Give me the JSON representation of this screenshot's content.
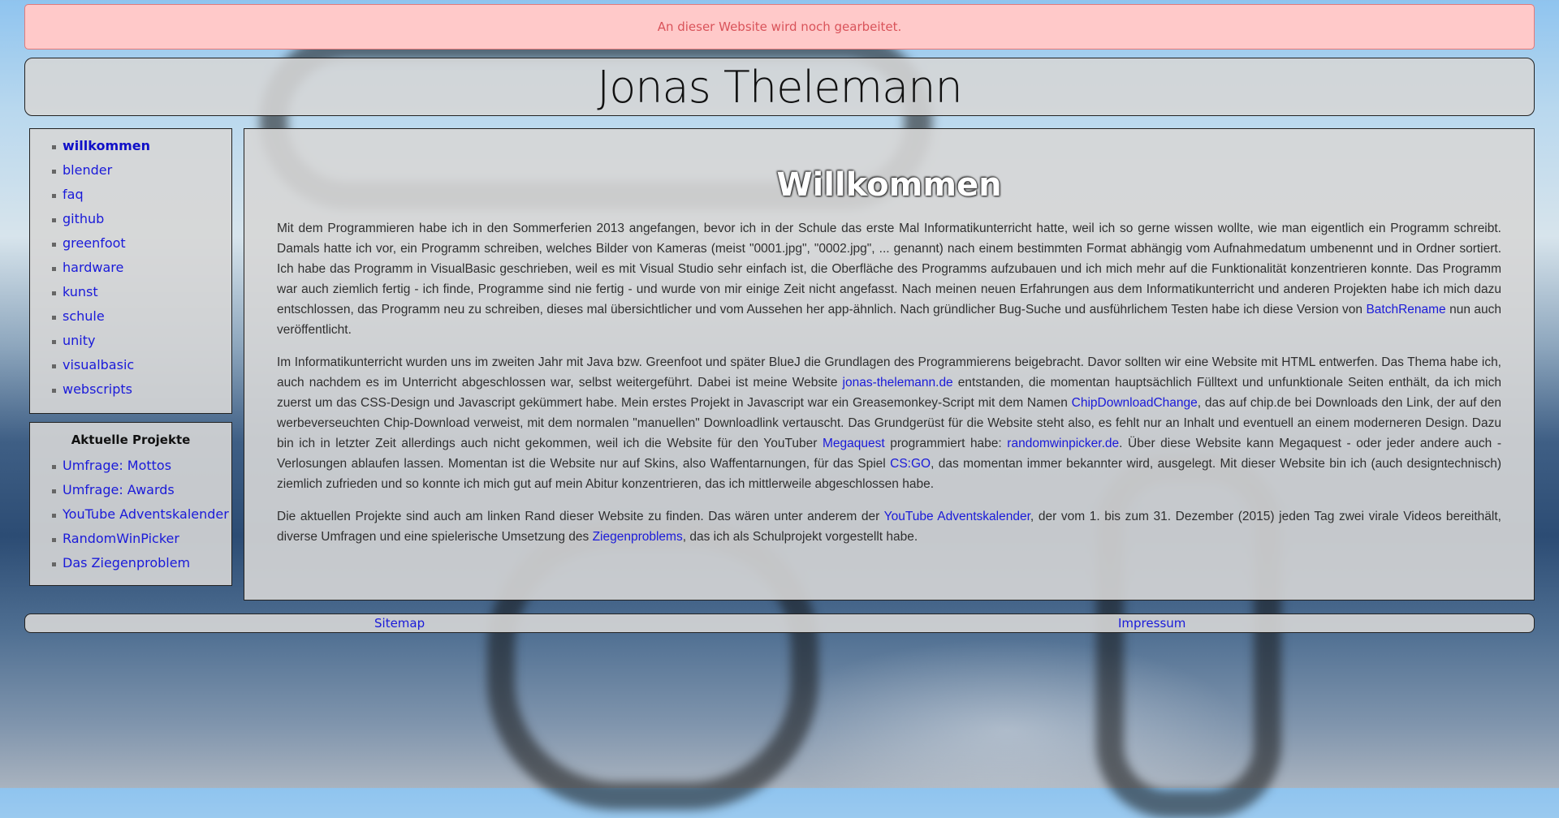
{
  "notice": "An dieser Website wird noch gearbeitet.",
  "header": {
    "title": "Jonas Thelemann"
  },
  "nav": {
    "items": [
      {
        "label": "willkommen",
        "active": true
      },
      {
        "label": "blender"
      },
      {
        "label": "faq"
      },
      {
        "label": "github"
      },
      {
        "label": "greenfoot"
      },
      {
        "label": "hardware"
      },
      {
        "label": "kunst"
      },
      {
        "label": "schule"
      },
      {
        "label": "unity"
      },
      {
        "label": "visualbasic"
      },
      {
        "label": "webscripts"
      }
    ]
  },
  "projects": {
    "title": "Aktuelle Projekte",
    "items": [
      {
        "label": "Umfrage: Mottos"
      },
      {
        "label": "Umfrage: Awards"
      },
      {
        "label": "YouTube Adventskalender"
      },
      {
        "label": "RandomWinPicker"
      },
      {
        "label": "Das Ziegenproblem"
      }
    ]
  },
  "main": {
    "title": "Willkommen",
    "p1": {
      "t1": "Mit dem Programmieren habe ich in den Sommerferien 2013 angefangen, bevor ich in der Schule das erste Mal Informatikunterricht hatte, weil ich so gerne wissen wollte, wie man eigentlich ein Programm schreibt. Damals hatte ich vor, ein Programm schreiben, welches Bilder von Kameras (meist \"0001.jpg\", \"0002.jpg\", ... genannt) nach einem bestimmten Format abhängig vom Aufnahmedatum umbenennt und in Ordner sortiert. Ich habe das Programm in VisualBasic geschrieben, weil es mit Visual Studio sehr einfach ist, die Oberfläche des Programms aufzubauen und ich mich mehr auf die Funktionalität konzentrieren konnte. Das Programm war auch ziemlich fertig - ich finde, Programme sind nie fertig - und wurde von mir einige Zeit nicht angefasst. Nach meinen neuen Erfahrungen aus dem Informatikunterricht und anderen Projekten habe ich mich dazu entschlossen, das Programm neu zu schreiben, dieses mal übersichtlicher und vom Aussehen her app-ähnlich. Nach gründlicher Bug-Suche und ausführlichem Testen habe ich diese Version von ",
      "link1": "BatchRename",
      "t2": " nun auch veröffentlicht."
    },
    "p2": {
      "t1": "Im Informatikunterricht wurden uns im zweiten Jahr mit Java bzw. Greenfoot und später BlueJ die Grundlagen des Programmierens beigebracht. Davor sollten wir eine Website mit HTML entwerfen. Das Thema habe ich, auch nachdem es im Unterricht abgeschlossen war, selbst weitergeführt. Dabei ist meine Website ",
      "link1": "jonas-thelemann.de",
      "t2": " entstanden, die momentan hauptsächlich Fülltext und unfunktionale Seiten enthält, da ich mich zuerst um das CSS-Design und Javascript gekümmert habe. Mein erstes Projekt in Javascript war ein Greasemonkey-Script mit dem Namen ",
      "link2": "ChipDownloadChange",
      "t3": ", das auf chip.de bei Downloads den Link, der auf den werbeverseuchten Chip-Download verweist, mit dem normalen \"manuellen\" Downloadlink vertauscht. Das Grundgerüst für die Website steht also, es fehlt nur an Inhalt und eventuell an einem moderneren Design. Dazu bin ich in letzter Zeit allerdings auch nicht gekommen, weil ich die Website für den YouTuber ",
      "link3": "Megaquest",
      "t4": " programmiert habe: ",
      "link4": "randomwinpicker.de",
      "t5": ". Über diese Website kann Megaquest - oder jeder andere auch - Verlosungen ablaufen lassen. Momentan ist die Website nur auf Skins, also Waffentarnungen, für das Spiel ",
      "link5": "CS:GO",
      "t6": ", das momentan immer bekannter wird, ausgelegt. Mit dieser Website bin ich (auch designtechnisch) ziemlich zufrieden und so konnte ich mich gut auf mein Abitur konzentrieren, das ich mittlerweile abgeschlossen habe."
    },
    "p3": {
      "t1": "Die aktuellen Projekte sind auch am linken Rand dieser Website zu finden. Das wären unter anderem der ",
      "link1": "YouTube Adventskalender",
      "t2": ", der vom 1. bis zum 31. Dezember (2015) jeden Tag zwei virale Videos bereithält, diverse Umfragen und eine spielerische Umsetzung des ",
      "link2": "Ziegenproblems",
      "t3": ", das ich als Schulprojekt vorgestellt habe."
    }
  },
  "footer": {
    "sitemap": "Sitemap",
    "impressum": "Impressum"
  },
  "colors": {
    "link": "#1a1ad9",
    "notice_bg": "#ffc9c9",
    "notice_text": "#d9535a"
  }
}
